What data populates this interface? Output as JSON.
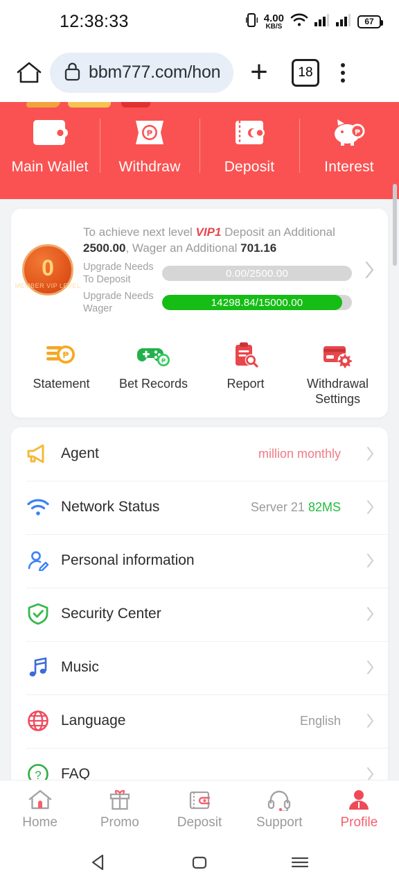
{
  "statusbar": {
    "time": "12:38:33",
    "net_speed_value": "4.00",
    "net_speed_unit": "KB/S",
    "battery": "67"
  },
  "browser": {
    "url": "bbm777.com/hon",
    "tab_count": "18"
  },
  "wallet_banner": {
    "bg_color": "#fa5252",
    "items": [
      {
        "label": "Main Wallet",
        "icon": "wallet-icon"
      },
      {
        "label": "Withdraw",
        "icon": "withdraw-ticket-icon"
      },
      {
        "label": "Deposit",
        "icon": "deposit-wallet-icon"
      },
      {
        "label": "Interest",
        "icon": "piggy-bank-icon"
      }
    ]
  },
  "vip_card": {
    "coin_level": "0",
    "coin_wreath": "MEMBER VIP LEVEL",
    "message_prefix": "To achieve next level ",
    "vip_tag": "VIP1",
    "message_mid": " Deposit an Additional ",
    "deposit_amount": "2500.00",
    "message_mid2": ", Wager an Additional ",
    "wager_amount": "701.16",
    "deposit_progress": {
      "label": "Upgrade Needs To Deposit",
      "text": "0.00/2500.00",
      "percent": 0
    },
    "wager_progress": {
      "label": "Upgrade Needs Wager",
      "text": "14298.84/15000.00",
      "percent": 95
    }
  },
  "quick_actions": [
    {
      "label": "Statement",
      "icon": "coins-stack-icon",
      "color": "#f5a623"
    },
    {
      "label": "Bet Records",
      "icon": "gamepad-icon",
      "color": "#22b24c"
    },
    {
      "label": "Report",
      "icon": "clipboard-search-icon",
      "color": "#e8464b"
    },
    {
      "label": "Withdrawal Settings",
      "icon": "card-gear-icon",
      "color": "#e8464b"
    }
  ],
  "menu": [
    {
      "label": "Agent",
      "icon": "megaphone-icon",
      "icon_color": "#f5b93a",
      "value": "million monthly",
      "value_style": "accent"
    },
    {
      "label": "Network Status",
      "icon": "wifi-icon",
      "icon_color": "#3b82f6",
      "value_server": "Server 21",
      "value_ms": "82MS"
    },
    {
      "label": "Personal information",
      "icon": "user-edit-icon",
      "icon_color": "#3b82f6",
      "value": ""
    },
    {
      "label": "Security Center",
      "icon": "shield-check-icon",
      "icon_color": "#35b84a",
      "value": ""
    },
    {
      "label": "Music",
      "icon": "music-note-icon",
      "icon_color": "#3b6bd6",
      "value": ""
    },
    {
      "label": "Language",
      "icon": "globe-icon",
      "icon_color": "#ef4a5e",
      "value": "English"
    },
    {
      "label": "FAQ",
      "icon": "question-circle-icon",
      "icon_color": "#2eac3e",
      "value": ""
    }
  ],
  "tabbar": {
    "active_color": "#f4606c",
    "items": [
      {
        "label": "Home",
        "icon": "home-icon",
        "active": false
      },
      {
        "label": "Promo",
        "icon": "gift-icon",
        "active": false
      },
      {
        "label": "Deposit",
        "icon": "wallet-icon",
        "active": false
      },
      {
        "label": "Support",
        "icon": "headset-icon",
        "active": false
      },
      {
        "label": "Profile",
        "icon": "person-icon",
        "active": true
      }
    ]
  },
  "android_nav": {
    "back": "back-triangle-icon",
    "home": "home-square-icon",
    "recents": "recents-lines-icon"
  }
}
